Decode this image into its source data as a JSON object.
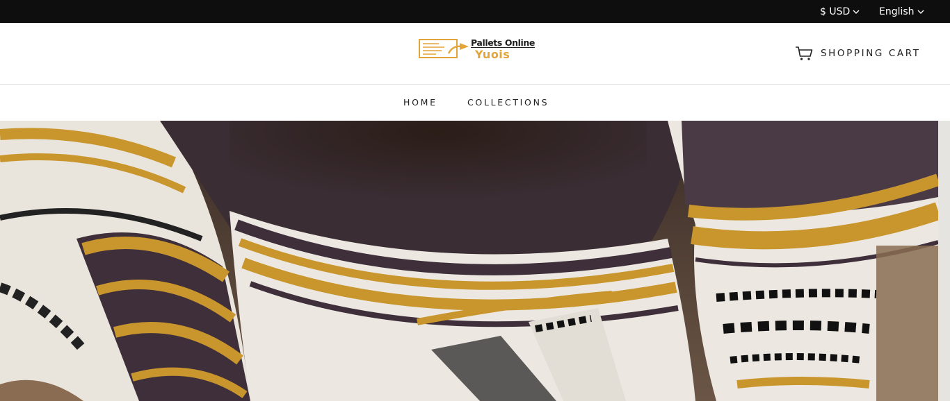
{
  "topbar": {
    "currency": "$ USD",
    "language": "English"
  },
  "logo": {
    "line1": "Pallets Online",
    "line2": "Yuois",
    "accent_color": "#e3a43a"
  },
  "header": {
    "cart_label": "SHOPPING CART",
    "cart_icon": "shopping-cart-icon"
  },
  "nav": {
    "items": [
      {
        "label": "HOME"
      },
      {
        "label": "COLLECTIONS"
      }
    ]
  },
  "hero": {
    "image": "woven-striped-blanket-photo",
    "colors": {
      "mustard": "#c9962e",
      "cream": "#ece8e1",
      "plum": "#3e2f3a"
    }
  }
}
